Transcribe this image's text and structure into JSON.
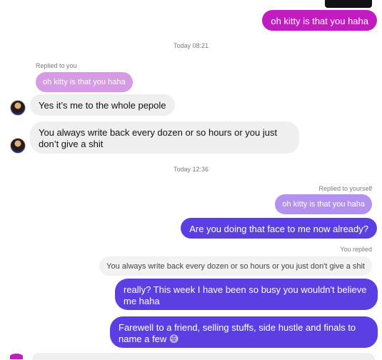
{
  "chat": {
    "messages": {
      "m1_out": "oh kitty is that you haha",
      "ts1": "Today 08:21",
      "reply_label_in": "Replied to you",
      "reply_quote_in": "oh kitty is that you haha",
      "m2_in": "Yes it’s me to the whole pepole",
      "m3_in": "You always write back every dozen or so hours or you just don’t give a shit",
      "ts2": "Today 12:36",
      "reply_label_self": "Replied to yourself",
      "reply_quote_self": "oh kitty is that you haha",
      "m4_out": "Are you doing that face to me now already?",
      "reply_label_you": "You replied",
      "reply_quote_you": "You always write back every dozen or so hours or you just don't give a shit",
      "m5_out": "really? This week I have been so busy you wouldn't believe me haha",
      "m6_out": "Farewell to a friend, selling stuffs, side hustle and finals to name a few 😅"
    }
  },
  "colors": {
    "outgoing_magenta": "#c21bc1",
    "outgoing_purple": "#5b3fe3",
    "incoming_gray": "#efefef"
  }
}
